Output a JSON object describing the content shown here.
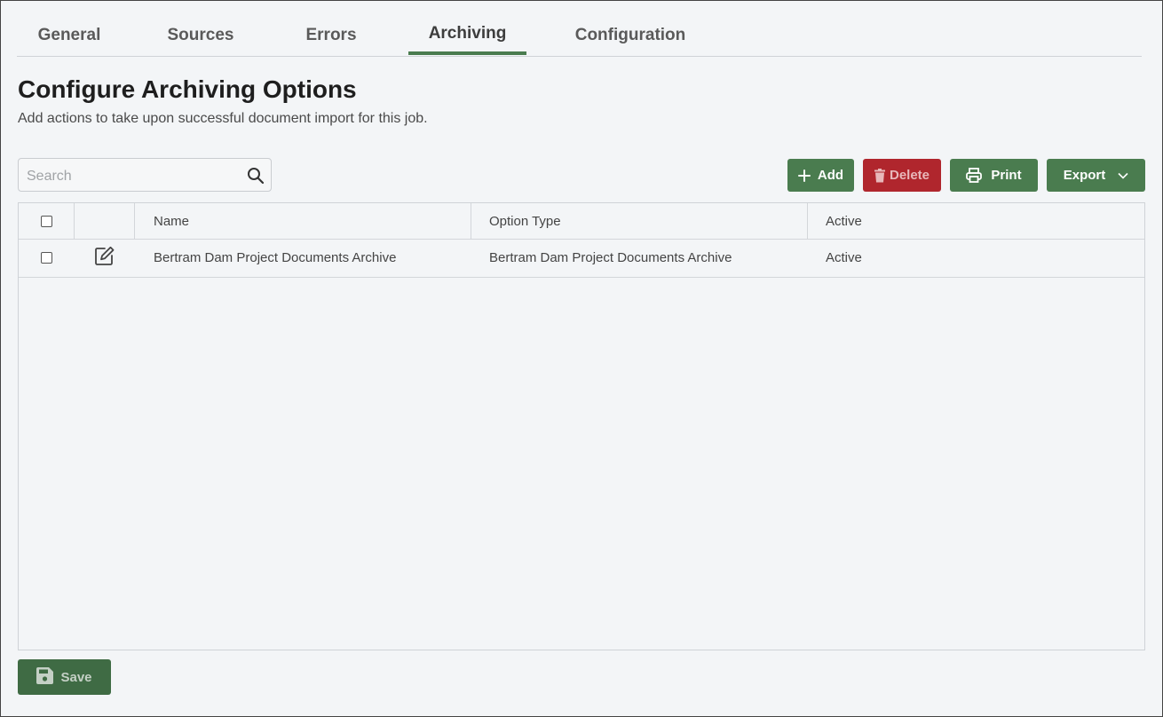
{
  "tabs": [
    {
      "label": "General"
    },
    {
      "label": "Sources"
    },
    {
      "label": "Errors"
    },
    {
      "label": "Archiving"
    },
    {
      "label": "Configuration"
    }
  ],
  "active_tab": "Archiving",
  "page": {
    "title": "Configure Archiving Options",
    "subtitle": "Add actions to take upon successful document import for this job."
  },
  "search": {
    "placeholder": "Search",
    "value": "",
    "icon": "search-icon"
  },
  "toolbar": {
    "add_label": "Add",
    "delete_label": "Delete",
    "print_label": "Print",
    "export_label": "Export"
  },
  "table": {
    "columns": [
      "Name",
      "Option Type",
      "Active"
    ],
    "rows": [
      {
        "name": "Bertram Dam Project Documents Archive",
        "option_type": "Bertram Dam Project Documents Archive",
        "active": "Active"
      }
    ]
  },
  "footer": {
    "save_label": "Save"
  },
  "colors": {
    "accent": "#4a7c4f",
    "danger": "#b0262d",
    "save": "#3f6b44",
    "background": "#f3f5f7"
  }
}
